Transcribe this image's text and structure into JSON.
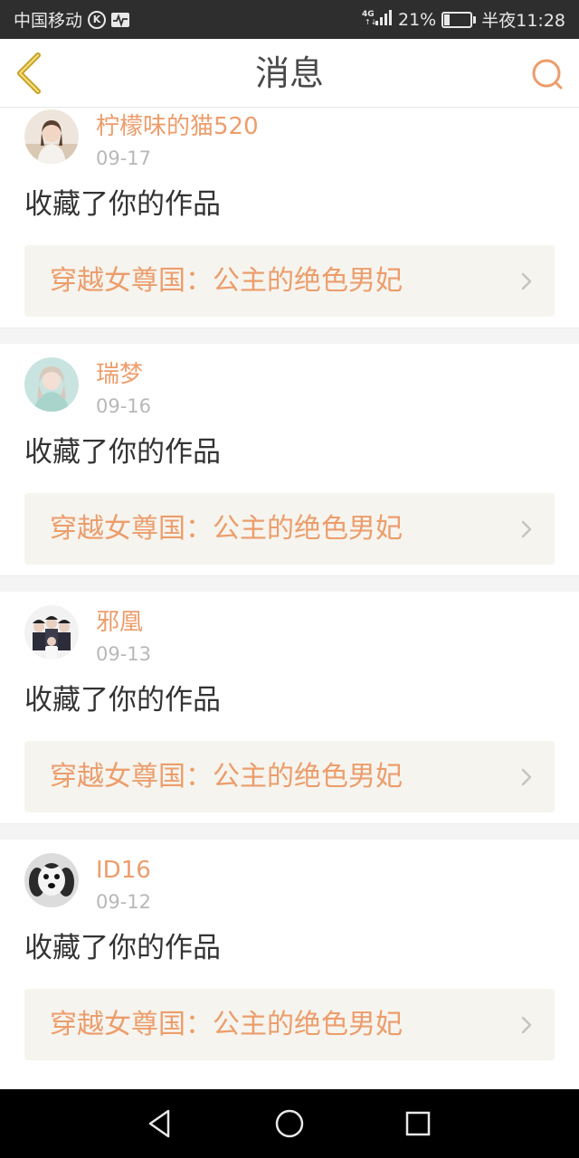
{
  "status_bar": {
    "carrier": "中国移动",
    "network": "4G",
    "battery_percent": "21%",
    "battery_level": 0.21,
    "time": "半夜11:28"
  },
  "header": {
    "title": "消息",
    "back_icon": "chevron-left-icon",
    "search_icon": "search-icon"
  },
  "colors": {
    "accent": "#ec9d6c",
    "back_arrow": "#c9a12a",
    "status_bar_bg": "#2e2e2e",
    "work_link_bg": "#f6f4ee",
    "nav_bar_bg": "#000000"
  },
  "messages": [
    {
      "username": "柠檬味的猫520",
      "date": "09-17",
      "action": "收藏了你的作品",
      "work_title": "穿越女尊国：公主的绝色男妃"
    },
    {
      "username": "瑞梦",
      "date": "09-16",
      "action": "收藏了你的作品",
      "work_title": "穿越女尊国：公主的绝色男妃"
    },
    {
      "username": "邪凰",
      "date": "09-13",
      "action": "收藏了你的作品",
      "work_title": "穿越女尊国：公主的绝色男妃"
    },
    {
      "username": "ID16",
      "date": "09-12",
      "action": "收藏了你的作品",
      "work_title": "穿越女尊国：公主的绝色男妃"
    }
  ],
  "nav_bar": {
    "icons": [
      "back-triangle-icon",
      "home-circle-icon",
      "recents-square-icon"
    ]
  }
}
